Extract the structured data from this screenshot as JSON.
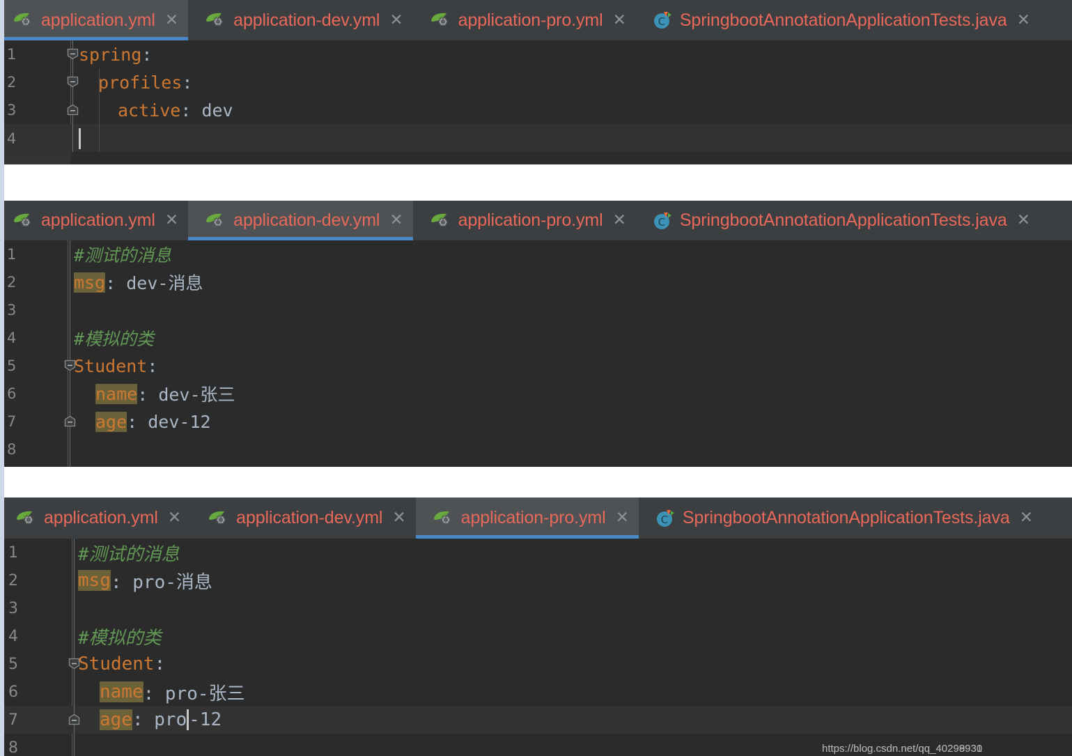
{
  "theme": {
    "editor_bg": "#2b2b2b",
    "gutter_bg": "#313335",
    "tabbar_bg": "#3c3f41",
    "tab_active_bg": "#4e5254",
    "tab_active_underline": "#4a88c7",
    "tab_label_color": "#e8685a",
    "key_color": "#cc7832",
    "value_color": "#a9b7c6",
    "comment_color": "#629755",
    "key_highlight_bg": "#6b6239",
    "current_line_bg": "#323232",
    "left_rail_color": "#ccd7e8",
    "page_gap_color": "#ffffff"
  },
  "panels": [
    {
      "id": "panel-application-yml",
      "tabs": [
        {
          "label": "application.yml",
          "icon": "spring-leaf-icon",
          "active": true,
          "closable": true
        },
        {
          "label": "application-dev.yml",
          "icon": "spring-leaf-icon",
          "active": false,
          "closable": true
        },
        {
          "label": "application-pro.yml",
          "icon": "spring-leaf-icon",
          "active": false,
          "closable": true
        },
        {
          "label": "SpringbootAnnotationApplicationTests.java",
          "icon": "junit-class-icon",
          "active": false,
          "closable": true
        }
      ],
      "lines": [
        {
          "no": "1",
          "current": false
        },
        {
          "no": "2",
          "current": false
        },
        {
          "no": "3",
          "current": false
        },
        {
          "no": "4",
          "current": true
        }
      ],
      "code": {
        "l1_key": "spring",
        "l1_colon": ":",
        "l2_key": "profiles",
        "l2_colon": ":",
        "l3_key": "active",
        "l3_colon": ":",
        "l3_value": "dev",
        "l4_text": ""
      }
    },
    {
      "id": "panel-application-dev-yml",
      "tabs": [
        {
          "label": "application.yml",
          "icon": "spring-leaf-icon",
          "active": false,
          "closable": true
        },
        {
          "label": "application-dev.yml",
          "icon": "spring-leaf-icon",
          "active": true,
          "closable": true
        },
        {
          "label": "application-pro.yml",
          "icon": "spring-leaf-icon",
          "active": false,
          "closable": true
        },
        {
          "label": "SpringbootAnnotationApplicationTests.java",
          "icon": "junit-class-icon",
          "active": false,
          "closable": true
        }
      ],
      "lines": [
        {
          "no": "1",
          "current": false
        },
        {
          "no": "2",
          "current": false
        },
        {
          "no": "3",
          "current": false
        },
        {
          "no": "4",
          "current": false
        },
        {
          "no": "5",
          "current": false
        },
        {
          "no": "6",
          "current": false
        },
        {
          "no": "7",
          "current": false
        },
        {
          "no": "8",
          "current": false
        }
      ],
      "code": {
        "l1_comment": "#测试的消息",
        "l2_key": "msg",
        "l2_rest": ": dev-消息",
        "l3_text": "",
        "l4_comment": "#模拟的类",
        "l5_key": "Student",
        "l5_colon": ":",
        "l6_key": "name",
        "l6_rest": ": dev-张三",
        "l7_key": "age",
        "l7_rest": ": dev-12",
        "l8_text": ""
      }
    },
    {
      "id": "panel-application-pro-yml",
      "tabs": [
        {
          "label": "application.yml",
          "icon": "spring-leaf-icon",
          "active": false,
          "closable": true
        },
        {
          "label": "application-dev.yml",
          "icon": "spring-leaf-icon",
          "active": false,
          "closable": true
        },
        {
          "label": "application-pro.yml",
          "icon": "spring-leaf-icon",
          "active": true,
          "closable": true
        },
        {
          "label": "SpringbootAnnotationApplicationTests.java",
          "icon": "junit-class-icon",
          "active": false,
          "closable": true
        }
      ],
      "lines": [
        {
          "no": "1",
          "current": false
        },
        {
          "no": "2",
          "current": false
        },
        {
          "no": "3",
          "current": false
        },
        {
          "no": "4",
          "current": false
        },
        {
          "no": "5",
          "current": false
        },
        {
          "no": "6",
          "current": false
        },
        {
          "no": "7",
          "current": true
        },
        {
          "no": "8",
          "current": false
        }
      ],
      "code": {
        "l1_comment": "#测试的消息",
        "l2_key": "msg",
        "l2_rest": ": pro-消息",
        "l3_text": "",
        "l4_comment": "#模拟的类",
        "l5_key": "Student",
        "l5_colon": ":",
        "l6_key": "name",
        "l6_rest": ": pro-张三",
        "l7_key": "age",
        "l7_sep": ": ",
        "l7_val_a": "pro",
        "l7_val_b": "-12",
        "l8_text": ""
      }
    }
  ],
  "watermark": {
    "line_a": "https://blog.csdn.net/qq_40298930",
    "line_b": "https://blog.csdn.net/qq_40299931"
  }
}
